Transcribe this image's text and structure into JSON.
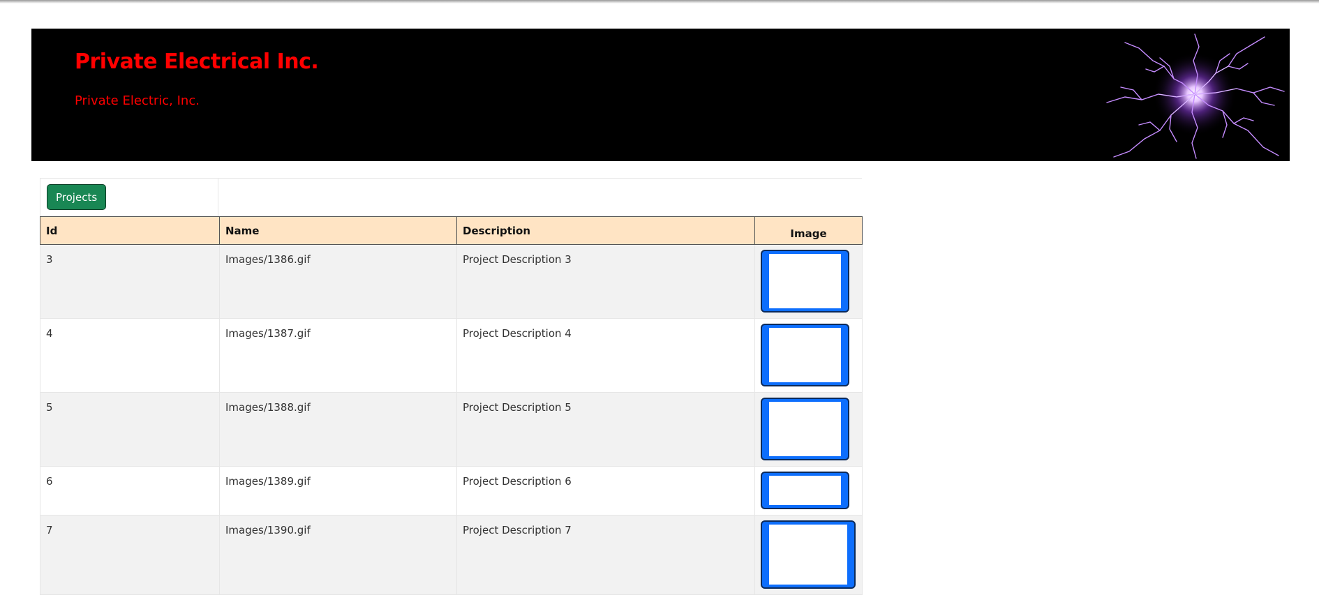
{
  "header": {
    "title": "Private Electrical Inc.",
    "subtitle": "Private Electric, Inc."
  },
  "toolbar": {
    "projects_label": "Projects"
  },
  "grid": {
    "columns": [
      "Id",
      "Name",
      "Description",
      "Image"
    ],
    "rows": [
      {
        "id": "3",
        "name": "Images/1386.gif",
        "description": "Project Description 3"
      },
      {
        "id": "4",
        "name": "Images/1387.gif",
        "description": "Project Description 4"
      },
      {
        "id": "5",
        "name": "Images/1388.gif",
        "description": "Project Description 5"
      },
      {
        "id": "6",
        "name": "Images/1389.gif",
        "description": "Project Description 6"
      },
      {
        "id": "7",
        "name": "Images/1390.gif",
        "description": "Project Description 7"
      }
    ]
  },
  "colors": {
    "banner_bg": "#000000",
    "title_color": "#ff0000",
    "button_green": "#198754",
    "header_bg": "#ffe4c4",
    "image_button_blue": "#0d6efd"
  }
}
